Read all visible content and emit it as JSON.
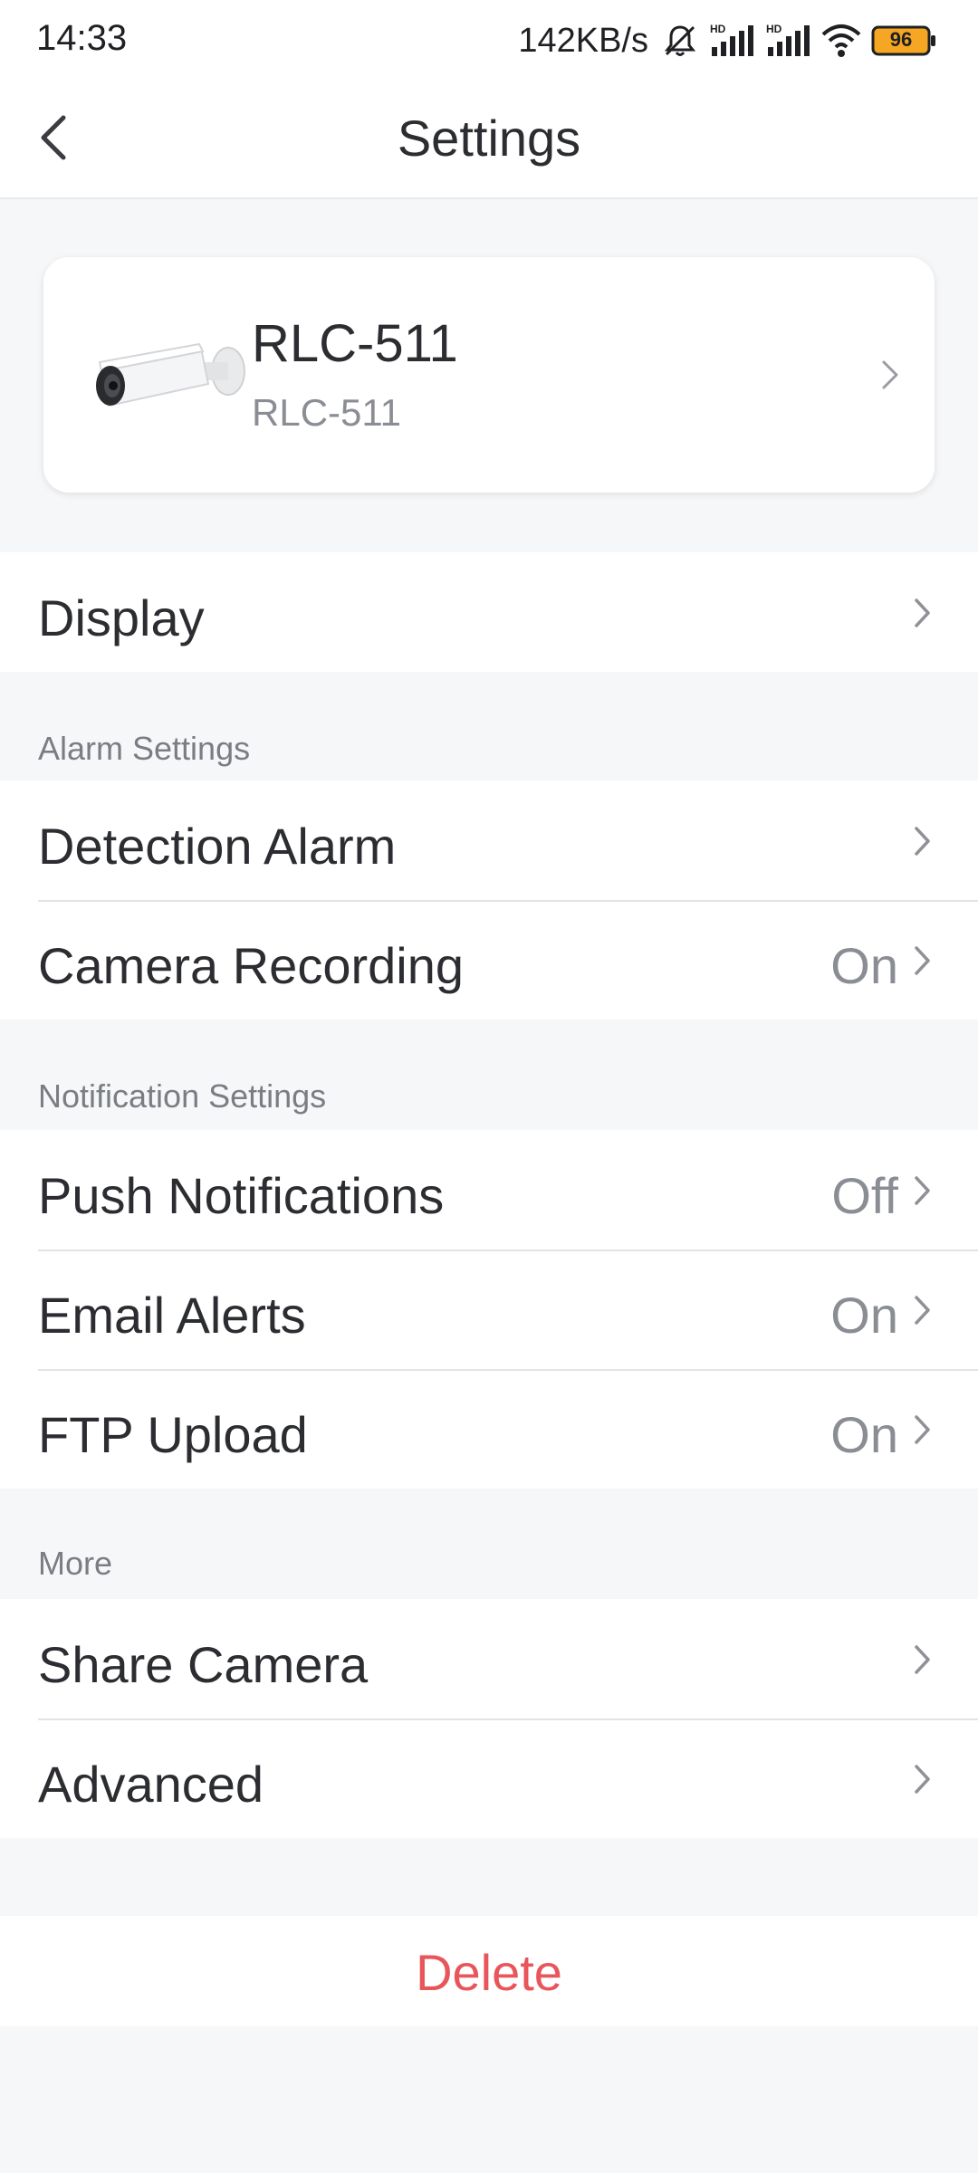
{
  "status_bar": {
    "time": "14:33",
    "net_speed": "142KB/s",
    "battery": "96",
    "icons": [
      "mute-icon",
      "signal-hd-icon",
      "signal-hd-icon",
      "wifi-icon",
      "battery-icon"
    ]
  },
  "header": {
    "title": "Settings"
  },
  "device": {
    "name": "RLC-511",
    "model": "RLC-511"
  },
  "groups": {
    "display": {
      "items": [
        {
          "label": "Display",
          "value": ""
        }
      ]
    },
    "alarm": {
      "header": "Alarm Settings",
      "items": [
        {
          "label": "Detection Alarm",
          "value": ""
        },
        {
          "label": "Camera Recording",
          "value": "On"
        }
      ]
    },
    "notification": {
      "header": "Notification Settings",
      "items": [
        {
          "label": "Push Notifications",
          "value": "Off"
        },
        {
          "label": "Email Alerts",
          "value": "On"
        },
        {
          "label": "FTP Upload",
          "value": "On"
        }
      ]
    },
    "more": {
      "header": "More",
      "items": [
        {
          "label": "Share Camera",
          "value": ""
        },
        {
          "label": "Advanced",
          "value": ""
        }
      ]
    }
  },
  "delete_label": "Delete",
  "colors": {
    "accent_delete": "#e8555a",
    "battery_fill": "#f5a623",
    "background": "#f6f7f9"
  }
}
